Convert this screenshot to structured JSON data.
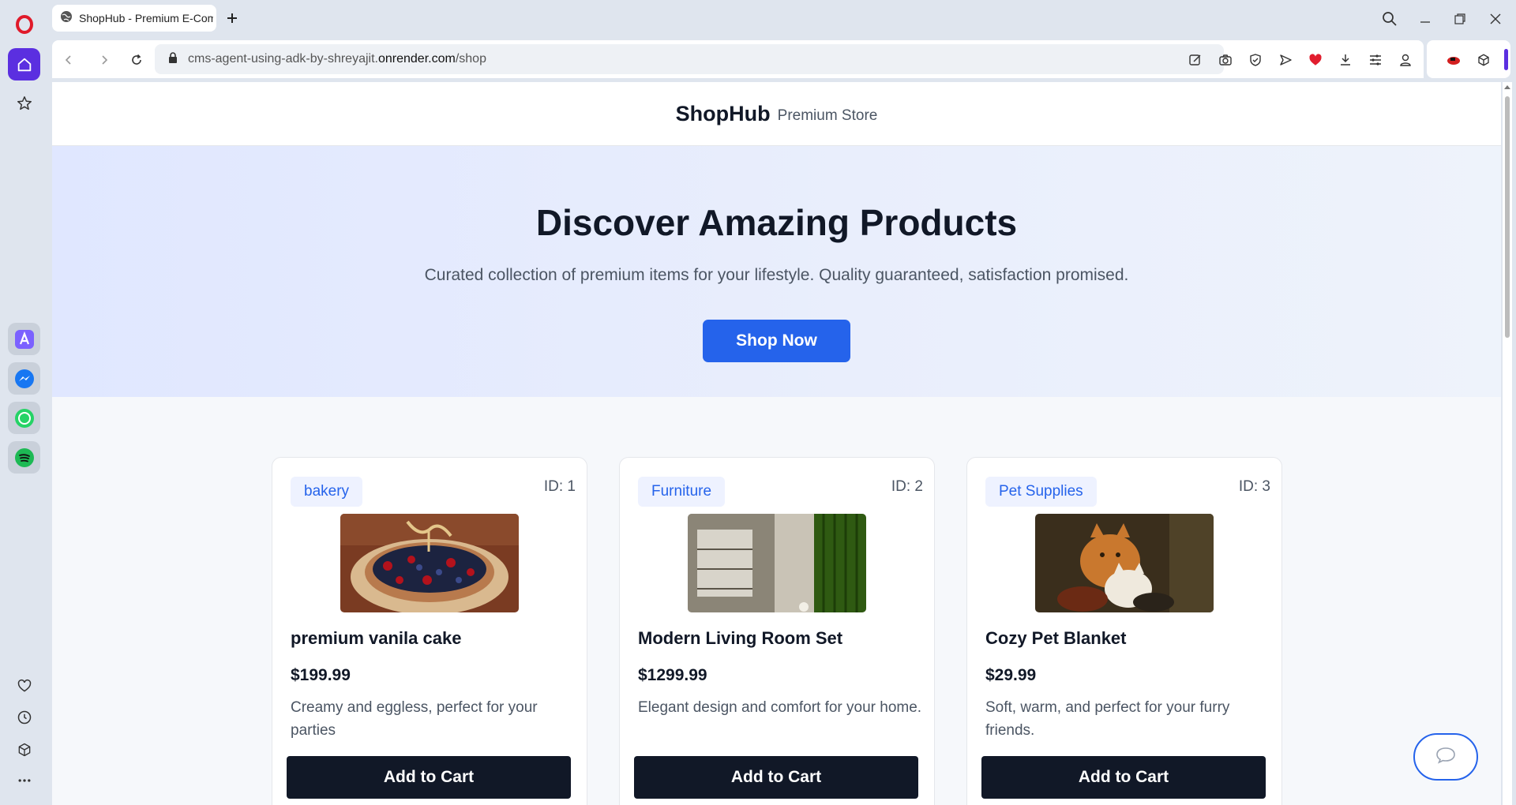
{
  "browser": {
    "tab": {
      "title": "ShopHub - Premium E-Commerce"
    },
    "address": {
      "url_path_prefix": "cms-agent-using-adk-by-shreyajit.",
      "url_domain": "onrender.com",
      "url_path": "/shop"
    }
  },
  "site": {
    "brand": "ShopHub",
    "brand_sub": "Premium Store"
  },
  "hero": {
    "title": "Discover Amazing Products",
    "subtitle": "Curated collection of premium items for your lifestyle. Quality guaranteed, satisfaction promised.",
    "cta": "Shop Now"
  },
  "products": [
    {
      "category": "bakery",
      "id_label": "ID: 1",
      "name": "premium vanila cake",
      "price": "$199.99",
      "description": "Creamy and eggless, perfect for your parties",
      "button": "Add to Cart"
    },
    {
      "category": "Furniture",
      "id_label": "ID: 2",
      "name": "Modern Living Room Set",
      "price": "$1299.99",
      "description": "Elegant design and comfort for your home.",
      "button": "Add to Cart"
    },
    {
      "category": "Pet Supplies",
      "id_label": "ID: 3",
      "name": "Cozy Pet Blanket",
      "price": "$29.99",
      "description": "Soft, warm, and perfect for your furry friends.",
      "button": "Add to Cart"
    }
  ],
  "colors": {
    "primary": "#2563eb",
    "dark_button": "#111827",
    "opera_accent": "#5b2fe0",
    "opera_logo": "#e01a2a"
  },
  "icons": {
    "sidebar": [
      "opera-logo-icon",
      "home-icon",
      "star-icon",
      "aria-icon",
      "messenger-icon",
      "whatsapp-icon",
      "spotify-icon",
      "heart-icon",
      "history-icon",
      "cube-icon",
      "more-icon"
    ],
    "toolbar": [
      "back-icon",
      "forward-icon",
      "reload-icon",
      "lock-icon",
      "edit-icon",
      "camera-icon",
      "shield-icon",
      "send-icon",
      "heart-icon",
      "download-icon",
      "easy-setup-icon",
      "profile-icon",
      "extension-icon",
      "cube-icon"
    ],
    "page": [
      "chat-bubble-icon"
    ]
  }
}
